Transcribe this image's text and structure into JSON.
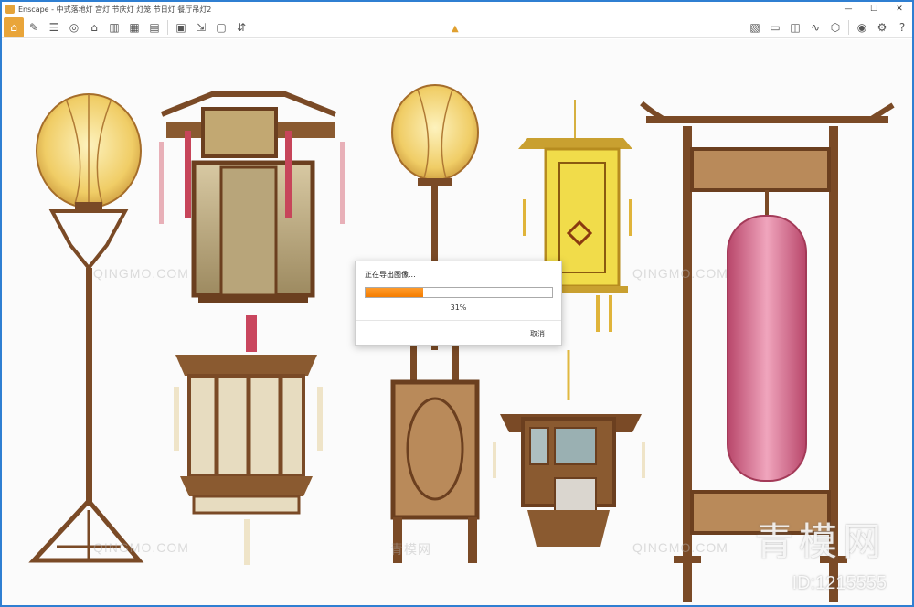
{
  "window": {
    "title": "Enscape - 中式落地灯 宫灯 节庆灯 灯笼 节日灯 餐厅吊灯2",
    "minimize": "—",
    "maximize": "☐",
    "close": "✕"
  },
  "toolbar": {
    "left_icons": [
      "home-icon",
      "pen-icon",
      "list-icon",
      "gamepad-icon",
      "house-icon",
      "asset-icon",
      "building-icon",
      "clapper-icon",
      "image-icon",
      "export-icon",
      "save-icon",
      "batch-icon"
    ],
    "right_icons": [
      "map-icon",
      "screen-icon",
      "vr-icon",
      "path-icon",
      "render-icon",
      "eye-icon",
      "settings-icon",
      "help-icon"
    ],
    "help_label": "?"
  },
  "watermarks": {
    "text": "QINGMO.COM",
    "brand": "青模网",
    "big": "青模网",
    "id": "ID:1215555"
  },
  "dialog": {
    "title": "正在导出图像...",
    "progress": 0.31,
    "percent_text": "31%",
    "cancel_label": "取消"
  },
  "colors": {
    "accent": "#e9a53a",
    "progress": "#f57c00",
    "wood": "#7a4a26",
    "lantern_yellow": "#f2d070",
    "lantern_red": "#d86b8a"
  }
}
